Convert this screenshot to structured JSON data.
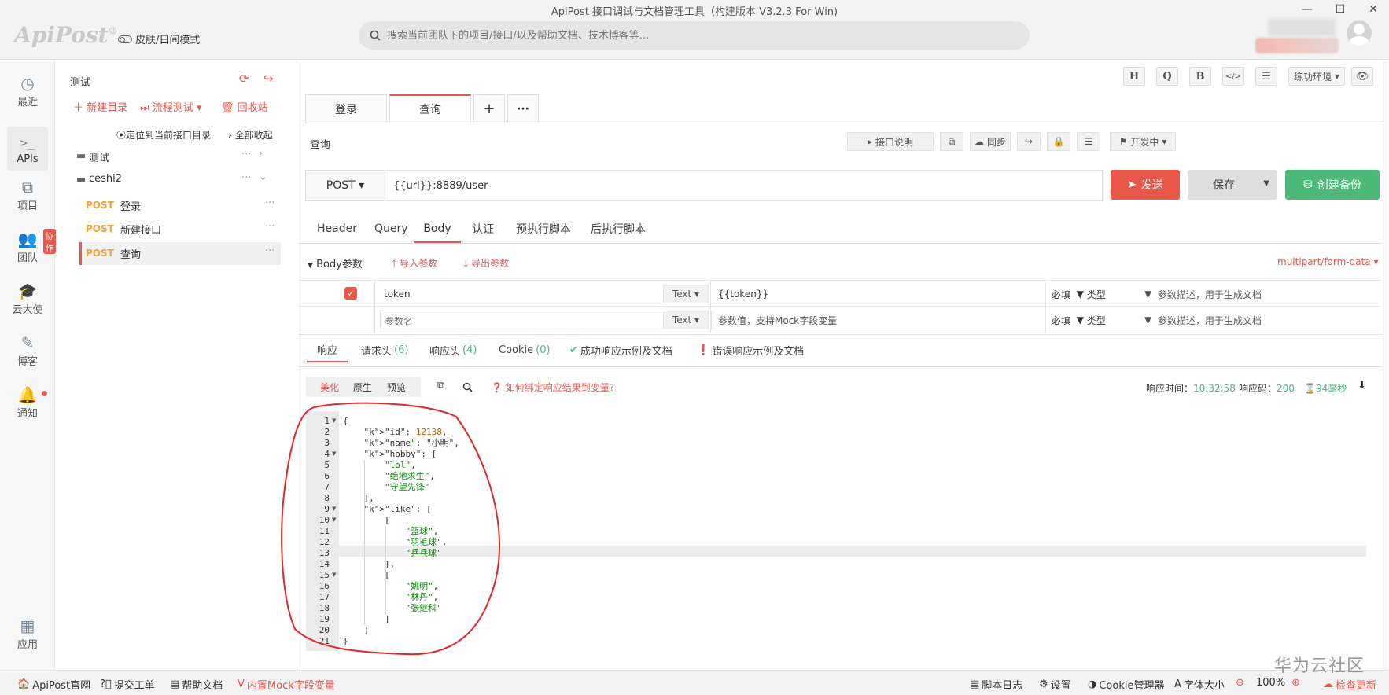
{
  "window": {
    "title": "ApiPost 接口调试与文档管理工具（构建版本 V3.2.3 For Win)",
    "logo_text": "ApiPost",
    "logo_mark": "®",
    "skin_toggle_label": "皮肤/日间模式",
    "search_placeholder": "搜索当前团队下的项目/接口/以及帮助文档、技术博客等..."
  },
  "left_nav": {
    "items": [
      {
        "label": "最近",
        "icon": "clock-icon"
      },
      {
        "label": "APIs",
        "icon": "terminal-icon"
      },
      {
        "label": "项目",
        "icon": "project-icon"
      },
      {
        "label": "团队",
        "icon": "team-icon",
        "badge": "协作"
      },
      {
        "label": "云大使",
        "icon": "graduation-icon"
      },
      {
        "label": "博客",
        "icon": "edit-icon"
      },
      {
        "label": "通知",
        "icon": "bell-icon"
      }
    ],
    "bottom_label": "应用"
  },
  "tree": {
    "project_name": "测试",
    "new_dir": "新建目录",
    "flow_test": "流程测试",
    "recycle": "回收站",
    "locate": "定位到当前接口目录",
    "collapse_all": "全部收起",
    "folders": [
      {
        "name": "测试"
      },
      {
        "name": "ceshi2"
      }
    ],
    "apis": [
      {
        "method": "POST",
        "name": "登录"
      },
      {
        "method": "POST",
        "name": "新建接口"
      },
      {
        "method": "POST",
        "name": "查询"
      }
    ]
  },
  "toolbar": {
    "buttons": [
      "H",
      "Q",
      "B"
    ],
    "env_label": "练功环境"
  },
  "tabs": [
    {
      "label": "登录"
    },
    {
      "label": "查询"
    }
  ],
  "tab_add": "+",
  "tab_more": "···",
  "interface": {
    "name": "查询",
    "desc_btn": "接口说明",
    "sync_btn": "同步",
    "status_btn": "开发中",
    "method": "POST",
    "url": "{{url}}:8889/user",
    "send": "发送",
    "save": "保存",
    "backup": "创建备份"
  },
  "request_tabs": [
    "Header",
    "Query",
    "Body",
    "认证",
    "预执行脚本",
    "后执行脚本"
  ],
  "body": {
    "title": "Body参数",
    "import": "导入参数",
    "export": "导出参数",
    "content_type": "multipart/form-data",
    "rows": [
      {
        "key": "token",
        "type": "Text",
        "value": "{{token}}",
        "required": "必填",
        "ptype": "类型",
        "desc": "参数描述，用于生成文档"
      }
    ],
    "empty_row": {
      "key_placeholder": "参数名",
      "type": "Text",
      "value_placeholder": "参数值，支持Mock字段变量",
      "required": "必填",
      "ptype": "类型",
      "desc": "参数描述，用于生成文档"
    }
  },
  "response": {
    "tabs": [
      {
        "label": "响应",
        "count": ""
      },
      {
        "label": "请求头",
        "count": "(6)"
      },
      {
        "label": "响应头",
        "count": "(4)"
      },
      {
        "label": "Cookie",
        "count": "(0)"
      },
      {
        "label": "成功响应示例及文档",
        "count": ""
      },
      {
        "label": "错误响应示例及文档",
        "count": ""
      }
    ],
    "view_modes": [
      "美化",
      "原生",
      "预览"
    ],
    "bind_hint": "如何绑定响应结果到变量?",
    "time_label": "响应时间：",
    "time_value": "10:32:58",
    "code_label": "响应码：",
    "code_value": "200",
    "duration": "94毫秒"
  },
  "code_lines": [
    "{",
    "    \"id\": 12138,",
    "    \"name\": \"小明\",",
    "    \"hobby\": [",
    "        \"lol\",",
    "        \"绝地求生\",",
    "        \"守望先锋\"",
    "    ],",
    "    \"like\": [",
    "        [",
    "            \"篮球\",",
    "            \"羽毛球\",",
    "            \"乒乓球\"",
    "        ],",
    "        [",
    "            \"姚明\",",
    "            \"林丹\",",
    "            \"张继科\"",
    "        ]",
    "    ]",
    "}"
  ],
  "statusbar": {
    "official": "ApiPost官网",
    "ticket": "提交工单",
    "help": "帮助文档",
    "mock": "内置Mock字段变量",
    "script_log": "脚本日志",
    "settings": "设置",
    "cookie_mgr": "Cookie管理器",
    "font_size": "字体大小",
    "zoom": "100%",
    "update": "检查更新"
  },
  "watermark": "华为云社区",
  "colors": {
    "accent": "#e9574b",
    "green": "#4cb978",
    "method": "#f0a43a"
  }
}
